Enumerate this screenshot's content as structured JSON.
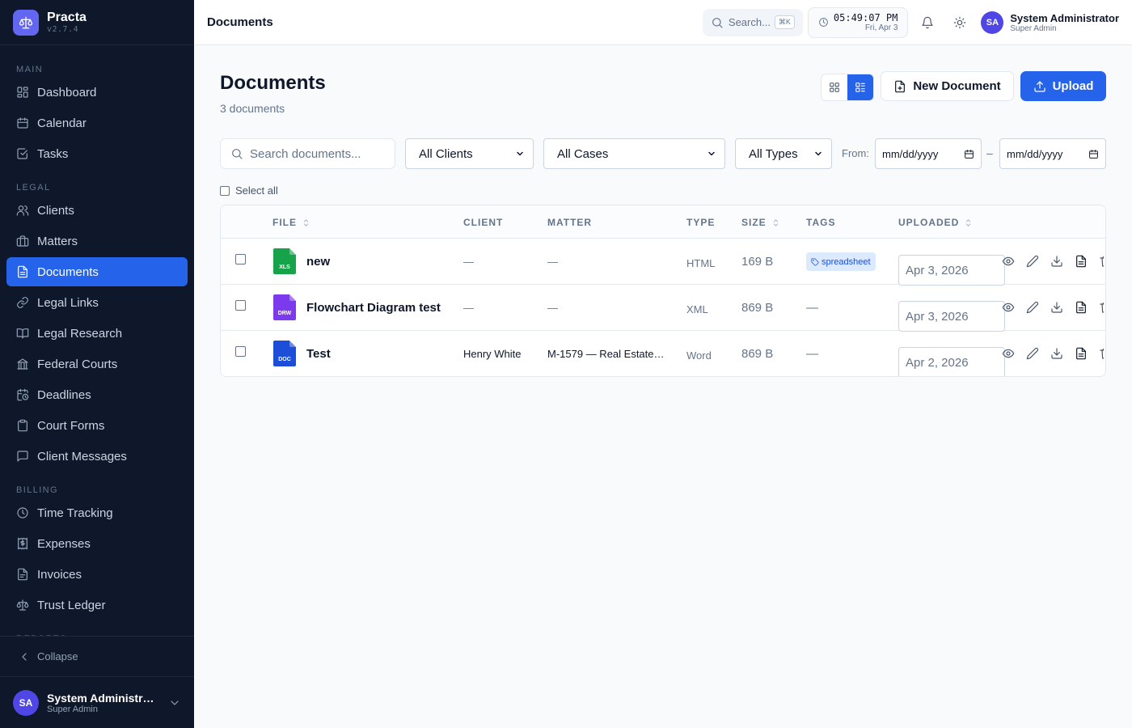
{
  "brand": {
    "name": "Practa",
    "version": "v2.7.4"
  },
  "sidebar": {
    "sections": [
      {
        "label": "MAIN",
        "items": [
          {
            "label": "Dashboard",
            "icon": "grid-icon"
          },
          {
            "label": "Calendar",
            "icon": "calendar-icon"
          },
          {
            "label": "Tasks",
            "icon": "check-square-icon"
          }
        ]
      },
      {
        "label": "LEGAL",
        "items": [
          {
            "label": "Clients",
            "icon": "users-icon"
          },
          {
            "label": "Matters",
            "icon": "briefcase-icon"
          },
          {
            "label": "Documents",
            "icon": "file-icon",
            "active": true
          },
          {
            "label": "Legal Links",
            "icon": "link-icon"
          },
          {
            "label": "Legal Research",
            "icon": "book-icon"
          },
          {
            "label": "Federal Courts",
            "icon": "landmark-icon"
          },
          {
            "label": "Deadlines",
            "icon": "calendar-clock-icon"
          },
          {
            "label": "Court Forms",
            "icon": "clipboard-icon"
          },
          {
            "label": "Client Messages",
            "icon": "message-icon"
          }
        ]
      },
      {
        "label": "BILLING",
        "items": [
          {
            "label": "Time Tracking",
            "icon": "clock-icon"
          },
          {
            "label": "Expenses",
            "icon": "receipt-icon"
          },
          {
            "label": "Invoices",
            "icon": "file-text-icon"
          },
          {
            "label": "Trust Ledger",
            "icon": "scale-icon"
          }
        ]
      },
      {
        "label": "REPORTS",
        "items": []
      }
    ],
    "collapse_label": "Collapse",
    "user": {
      "initials": "SA",
      "name": "System Administrator",
      "role": "Super Admin"
    }
  },
  "header": {
    "title": "Documents",
    "search_label": "Search...",
    "search_kbd": "⌘K",
    "time": "05:49:07 PM",
    "date": "Fri, Apr 3",
    "user": {
      "initials": "SA",
      "name": "System Administrator",
      "role": "Super Admin"
    }
  },
  "page": {
    "title": "Documents",
    "subtitle": "3 documents",
    "new_label": "New Document",
    "upload_label": "Upload"
  },
  "filters": {
    "search_placeholder": "Search documents...",
    "clients": "All Clients",
    "cases": "All Cases",
    "types": "All Types",
    "from_label": "From:",
    "date_from": "mm/dd/yyyy",
    "date_sep": "–",
    "date_to": "mm/dd/yyyy",
    "select_all": "Select all"
  },
  "table": {
    "columns": [
      "FILE",
      "CLIENT",
      "MATTER",
      "TYPE",
      "SIZE",
      "TAGS",
      "UPLOADED"
    ],
    "rows": [
      {
        "name": "new",
        "badge": "XLS",
        "badge_color": "#16a34a",
        "client": "—",
        "matter": "—",
        "type": "HTML",
        "size": "169 B",
        "tag": "spreadsheet",
        "uploaded": "Apr 3, 2026"
      },
      {
        "name": "Flowchart Diagram test",
        "badge": "DRW",
        "badge_color": "#7c3aed",
        "client": "—",
        "matter": "—",
        "type": "XML",
        "size": "869 B",
        "tag": "—",
        "uploaded": "Apr 3, 2026"
      },
      {
        "name": "Test",
        "badge": "DOC",
        "badge_color": "#1d4ed8",
        "client": "Henry White",
        "matter": "M-1579 — Real Estate…",
        "type": "Word",
        "size": "869 B",
        "tag": "—",
        "uploaded": "Apr 2, 2026"
      }
    ]
  },
  "colors": {
    "accent": "#2563eb",
    "sidebar_bg": "#0f172a",
    "brand": "#6366f1"
  }
}
